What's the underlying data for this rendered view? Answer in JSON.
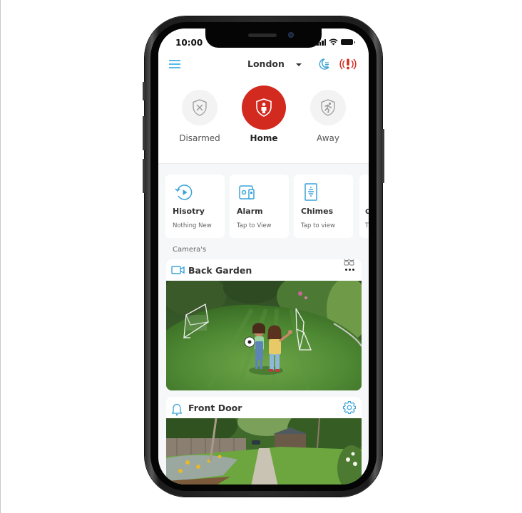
{
  "status_bar": {
    "time": "10:00"
  },
  "header": {
    "location": "London",
    "menu_icon": "hamburger-menu-icon",
    "night_mode_icon": "moon-icon",
    "panic_icon": "panic-alarm-icon"
  },
  "modes": [
    {
      "label": "Disarmed",
      "icon": "shield-x-icon",
      "active": false
    },
    {
      "label": "Home",
      "icon": "shield-person-icon",
      "active": true
    },
    {
      "label": "Away",
      "icon": "shield-running-icon",
      "active": false
    }
  ],
  "colors": {
    "accent_blue": "#3aa3dc",
    "alert_red": "#d32a20",
    "background": "#f6f7f9"
  },
  "tiles": [
    {
      "title": "Hisotry",
      "subtitle": "Nothing New",
      "icon": "history-play-icon"
    },
    {
      "title": "Alarm",
      "subtitle": "Tap to View",
      "icon": "alarm-device-icon"
    },
    {
      "title": "Chimes",
      "subtitle": "Tap to view",
      "icon": "chime-device-icon"
    },
    {
      "title": "C",
      "subtitle": "T",
      "icon": ""
    }
  ],
  "cameras_section": {
    "label": "Camera's",
    "cameras": [
      {
        "name": "Back Garden",
        "type_icon": "video-camera-icon",
        "feed": "Children playing football on a lawn with two goals"
      },
      {
        "name": "Front Door",
        "type_icon": "doorbell-icon",
        "feed": "Garden path leading to a wooden outbuilding"
      }
    ]
  }
}
